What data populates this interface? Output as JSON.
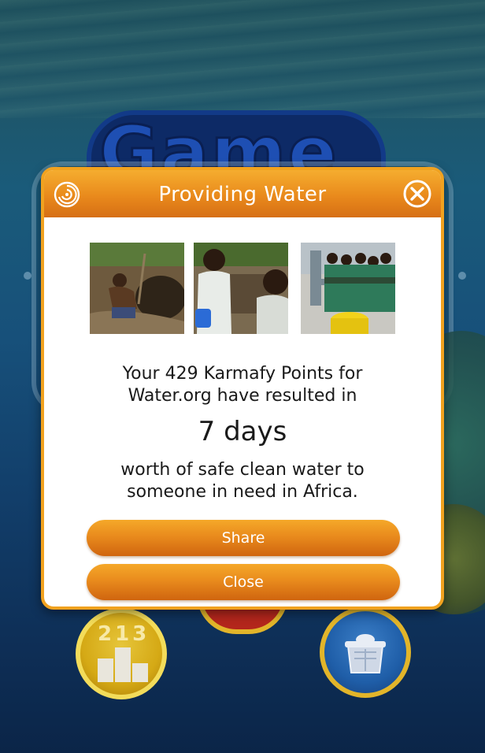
{
  "dialog": {
    "title": "Providing Water",
    "message_line1": "Your 429 Karmafy Points for",
    "message_line2": "Water.org have resulted in",
    "highlight": "7 days",
    "message_line3": "worth of safe clean water to",
    "message_line4": "someone in need in Africa.",
    "share_label": "Share",
    "close_label": "Close"
  },
  "background": {
    "leaderboard_digits": "213"
  },
  "icons": {
    "header_left": "swirl-icon",
    "header_right": "close-icon",
    "leaderboard": "podium-icon",
    "store": "store-icon"
  },
  "colors": {
    "accent_orange": "#e98a1c",
    "dialog_border": "#f1a21f",
    "text": "#1a1a1a"
  }
}
